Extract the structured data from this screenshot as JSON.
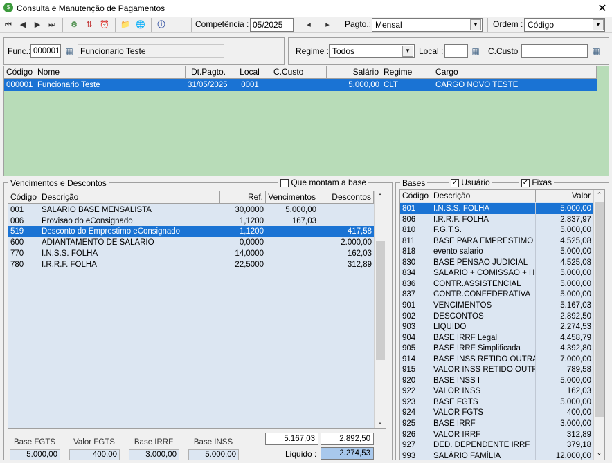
{
  "window": {
    "title": "Consulta e Manutenção de Pagamentos",
    "close": "✕"
  },
  "toolbar": {
    "nav": [
      "⏮",
      "◀",
      "▶",
      "⏭"
    ],
    "tools": [
      "⚙",
      "⇅",
      "⏰",
      "📁",
      "🌐",
      "ⓘ"
    ],
    "competencia_label": "Competência :",
    "competencia_value": "05/2025",
    "pagto_label": "Pagto.:",
    "pagto_value": "Mensal",
    "ordem_label": "Ordem :",
    "ordem_value": "Código"
  },
  "filter": {
    "func_label": "Func.:",
    "func_code": "000001",
    "func_name": "Funcionario Teste",
    "regime_label": "Regime :",
    "regime_value": "Todos",
    "local_label": "Local :",
    "local_value": "",
    "ccusto_label": "C.Custo :",
    "ccusto_value": ""
  },
  "employees": {
    "columns": [
      "Código",
      "Nome",
      "Dt.Pagto.",
      "Local",
      "C.Custo",
      "Salário",
      "Regime",
      "Cargo"
    ],
    "rows": [
      [
        "000001",
        "Funcionario Teste",
        "31/05/2025",
        "0001",
        "",
        "5.000,00",
        "CLT",
        "CARGO NOVO TESTE"
      ]
    ]
  },
  "venc": {
    "group_label": "Vencimentos e Descontos",
    "checkbox_label": "Que montam a base",
    "columns": [
      "Código",
      "Descrição",
      "Ref.",
      "Vencimentos",
      "Descontos"
    ],
    "rows": [
      [
        "001",
        "SALARIO BASE MENSALISTA",
        "30,0000",
        "5.000,00",
        ""
      ],
      [
        "006",
        "Provisao do eConsignado",
        "1,1200",
        "167,03",
        ""
      ],
      [
        "519",
        "Desconto do Emprestimo eConsignado",
        "1,1200",
        "",
        "417,58"
      ],
      [
        "600",
        "ADIANTAMENTO DE SALARIO",
        "0,0000",
        "",
        "2.000,00"
      ],
      [
        "770",
        "I.N.S.S. FOLHA",
        "14,0000",
        "",
        "162,03"
      ],
      [
        "780",
        "I.R.R.F. FOLHA",
        "22,5000",
        "",
        "312,89"
      ]
    ],
    "selected": 2
  },
  "footer": {
    "labels": [
      "Base FGTS",
      "Valor FGTS",
      "Base IRRF",
      "Base INSS"
    ],
    "values": [
      "5.000,00",
      "400,00",
      "3.000,00",
      "5.000,00"
    ],
    "total_venc": "5.167,03",
    "total_desc": "2.892,50",
    "liquido_label": "Liquido :",
    "liquido_value": "2.274,53"
  },
  "bases": {
    "group_label": "Bases",
    "usuario_label": "Usuário",
    "fixas_label": "Fixas",
    "check": "✓",
    "columns": [
      "Código",
      "Descrição",
      "Valor"
    ],
    "rows": [
      [
        "801",
        "I.N.S.S. FOLHA",
        "5.000,00"
      ],
      [
        "806",
        "I.R.R.F. FOLHA",
        "2.837,97"
      ],
      [
        "810",
        "F.G.T.S.",
        "5.000,00"
      ],
      [
        "811",
        "BASE PARA EMPRESTIMO ECO",
        "4.525,08"
      ],
      [
        "818",
        "evento salario",
        "5.000,00"
      ],
      [
        "830",
        "BASE PENSAO JUDICIAL",
        "4.525,08"
      ],
      [
        "834",
        "SALARIO + COMISSAO + H.E.",
        "5.000,00"
      ],
      [
        "836",
        "CONTR.ASSISTENCIAL",
        "5.000,00"
      ],
      [
        "837",
        "CONTR.CONFEDERATIVA",
        "5.000,00"
      ],
      [
        "901",
        "VENCIMENTOS",
        "5.167,03"
      ],
      [
        "902",
        "DESCONTOS",
        "2.892,50"
      ],
      [
        "903",
        "LIQUIDO",
        "2.274,53"
      ],
      [
        "904",
        "BASE IRRF Legal",
        "4.458,79"
      ],
      [
        "905",
        "BASE IRRF Simplificada",
        "4.392,80"
      ],
      [
        "914",
        "BASE INSS RETIDO OUTRAS EM",
        "7.000,00"
      ],
      [
        "915",
        "VALOR INSS RETIDO OUTRAS",
        "789,58"
      ],
      [
        "920",
        "BASE INSS I",
        "5.000,00"
      ],
      [
        "922",
        "VALOR INSS",
        "162,03"
      ],
      [
        "923",
        "BASE FGTS",
        "5.000,00"
      ],
      [
        "924",
        "VALOR FGTS",
        "400,00"
      ],
      [
        "925",
        "BASE IRRF",
        "3.000,00"
      ],
      [
        "926",
        "VALOR IRRF",
        "312,89"
      ],
      [
        "927",
        "DED. DEPENDENTE IRRF",
        "379,18"
      ],
      [
        "993",
        "SALÁRIO FAMÍLIA",
        "12.000,00"
      ]
    ],
    "selected": 0
  }
}
